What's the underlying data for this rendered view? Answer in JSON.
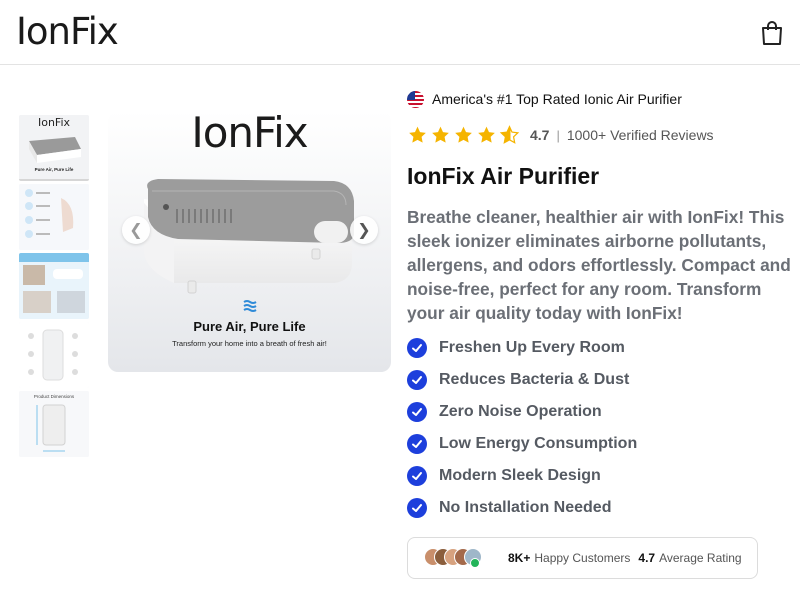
{
  "header": {
    "logo": "IonFix",
    "cart_icon": "shopping-bag-icon"
  },
  "gallery": {
    "thumbnails": [
      {
        "label": "IonFix",
        "sub": "Pure Air, Pure Life"
      },
      {
        "label": ""
      },
      {
        "label": ""
      },
      {
        "label": ""
      },
      {
        "label": "Product Dimensions"
      }
    ],
    "main": {
      "logo": "IonFix",
      "tagline": "Pure Air, Pure Life",
      "subtag": "Transform your home into a breath of fresh air!",
      "prev_icon": "chevron-left-icon",
      "next_icon": "chevron-right-icon"
    }
  },
  "product": {
    "badge": "America's #1 Top Rated Ionic Air Purifier",
    "rating": "4.7",
    "separator": "|",
    "reviews": "1000+ Verified Reviews",
    "stars": 4.7,
    "title": "IonFix Air Purifier",
    "description": "Breathe cleaner, healthier air with IonFix! This sleek ionizer eliminates airborne pollutants, allergens, and odors effortlessly. Compact and noise-free, perfect for any room. Transform your air quality today with IonFix!",
    "features": [
      "Freshen Up Every Room",
      "Reduces Bacteria & Dust",
      "Zero Noise Operation",
      "Low Energy Consumption",
      "Modern Sleek Design",
      "No Installation Needed"
    ],
    "social": {
      "customers_count": "8K+",
      "customers_label": "Happy Customers",
      "avg_rating": "4.7",
      "avg_label": "Average Rating"
    }
  },
  "colors": {
    "accent": "#1d3fdc",
    "star": "#f5b400",
    "text_muted": "#6b6f76"
  }
}
